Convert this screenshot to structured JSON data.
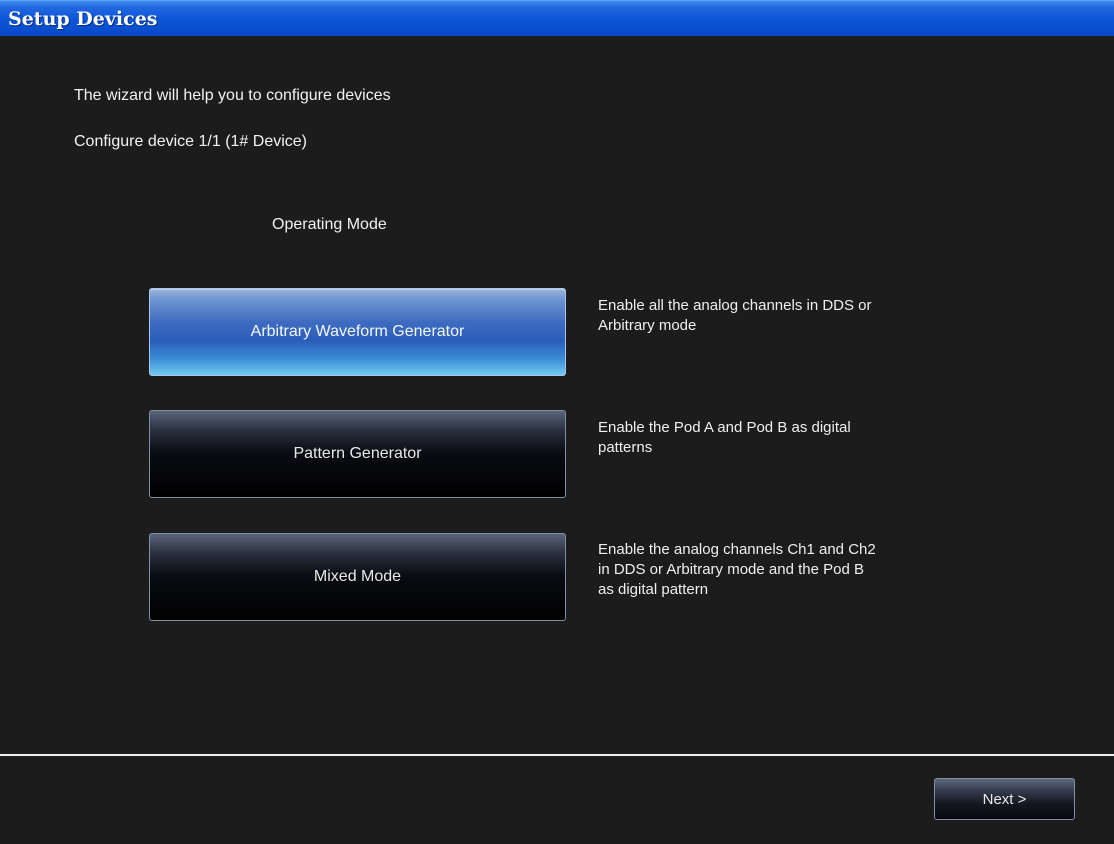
{
  "window": {
    "title": "Setup Devices"
  },
  "wizard": {
    "intro": "The wizard will help you to configure devices",
    "configure_line": "Configure device 1/1 (1# Device)",
    "mode_heading": "Operating Mode"
  },
  "modes": [
    {
      "label": "Arbitrary Waveform Generator",
      "description": "Enable all the analog channels in DDS or\nArbitrary mode",
      "selected": true
    },
    {
      "label": "Pattern Generator",
      "description": "Enable the Pod A and Pod B as digital\npatterns",
      "selected": false
    },
    {
      "label": "Mixed Mode",
      "description": "Enable the analog channels Ch1 and Ch2\nin DDS or Arbitrary mode and the Pod B\nas digital pattern",
      "selected": false
    }
  ],
  "footer": {
    "next_label": "Next >"
  },
  "colors": {
    "background": "#1c1c1c",
    "titlebar": "#0c56da",
    "selected_button": "#3f6cc0",
    "separator": "#f0f0f0"
  }
}
